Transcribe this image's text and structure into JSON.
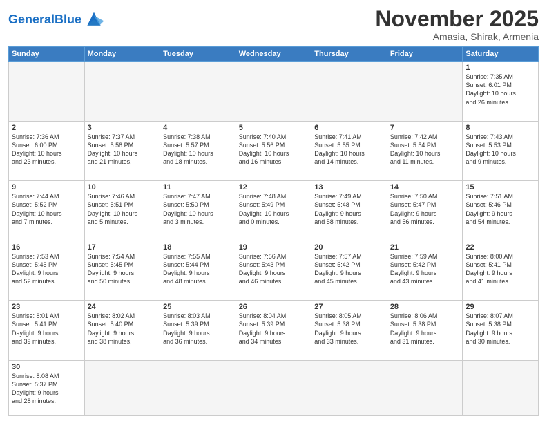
{
  "header": {
    "logo_general": "General",
    "logo_blue": "Blue",
    "month": "November 2025",
    "location": "Amasia, Shirak, Armenia"
  },
  "days_of_week": [
    "Sunday",
    "Monday",
    "Tuesday",
    "Wednesday",
    "Thursday",
    "Friday",
    "Saturday"
  ],
  "weeks": [
    [
      {
        "day": "",
        "info": ""
      },
      {
        "day": "",
        "info": ""
      },
      {
        "day": "",
        "info": ""
      },
      {
        "day": "",
        "info": ""
      },
      {
        "day": "",
        "info": ""
      },
      {
        "day": "",
        "info": ""
      },
      {
        "day": "1",
        "info": "Sunrise: 7:35 AM\nSunset: 6:01 PM\nDaylight: 10 hours\nand 26 minutes."
      }
    ],
    [
      {
        "day": "2",
        "info": "Sunrise: 7:36 AM\nSunset: 6:00 PM\nDaylight: 10 hours\nand 23 minutes."
      },
      {
        "day": "3",
        "info": "Sunrise: 7:37 AM\nSunset: 5:58 PM\nDaylight: 10 hours\nand 21 minutes."
      },
      {
        "day": "4",
        "info": "Sunrise: 7:38 AM\nSunset: 5:57 PM\nDaylight: 10 hours\nand 18 minutes."
      },
      {
        "day": "5",
        "info": "Sunrise: 7:40 AM\nSunset: 5:56 PM\nDaylight: 10 hours\nand 16 minutes."
      },
      {
        "day": "6",
        "info": "Sunrise: 7:41 AM\nSunset: 5:55 PM\nDaylight: 10 hours\nand 14 minutes."
      },
      {
        "day": "7",
        "info": "Sunrise: 7:42 AM\nSunset: 5:54 PM\nDaylight: 10 hours\nand 11 minutes."
      },
      {
        "day": "8",
        "info": "Sunrise: 7:43 AM\nSunset: 5:53 PM\nDaylight: 10 hours\nand 9 minutes."
      }
    ],
    [
      {
        "day": "9",
        "info": "Sunrise: 7:44 AM\nSunset: 5:52 PM\nDaylight: 10 hours\nand 7 minutes."
      },
      {
        "day": "10",
        "info": "Sunrise: 7:46 AM\nSunset: 5:51 PM\nDaylight: 10 hours\nand 5 minutes."
      },
      {
        "day": "11",
        "info": "Sunrise: 7:47 AM\nSunset: 5:50 PM\nDaylight: 10 hours\nand 3 minutes."
      },
      {
        "day": "12",
        "info": "Sunrise: 7:48 AM\nSunset: 5:49 PM\nDaylight: 10 hours\nand 0 minutes."
      },
      {
        "day": "13",
        "info": "Sunrise: 7:49 AM\nSunset: 5:48 PM\nDaylight: 9 hours\nand 58 minutes."
      },
      {
        "day": "14",
        "info": "Sunrise: 7:50 AM\nSunset: 5:47 PM\nDaylight: 9 hours\nand 56 minutes."
      },
      {
        "day": "15",
        "info": "Sunrise: 7:51 AM\nSunset: 5:46 PM\nDaylight: 9 hours\nand 54 minutes."
      }
    ],
    [
      {
        "day": "16",
        "info": "Sunrise: 7:53 AM\nSunset: 5:45 PM\nDaylight: 9 hours\nand 52 minutes."
      },
      {
        "day": "17",
        "info": "Sunrise: 7:54 AM\nSunset: 5:45 PM\nDaylight: 9 hours\nand 50 minutes."
      },
      {
        "day": "18",
        "info": "Sunrise: 7:55 AM\nSunset: 5:44 PM\nDaylight: 9 hours\nand 48 minutes."
      },
      {
        "day": "19",
        "info": "Sunrise: 7:56 AM\nSunset: 5:43 PM\nDaylight: 9 hours\nand 46 minutes."
      },
      {
        "day": "20",
        "info": "Sunrise: 7:57 AM\nSunset: 5:42 PM\nDaylight: 9 hours\nand 45 minutes."
      },
      {
        "day": "21",
        "info": "Sunrise: 7:59 AM\nSunset: 5:42 PM\nDaylight: 9 hours\nand 43 minutes."
      },
      {
        "day": "22",
        "info": "Sunrise: 8:00 AM\nSunset: 5:41 PM\nDaylight: 9 hours\nand 41 minutes."
      }
    ],
    [
      {
        "day": "23",
        "info": "Sunrise: 8:01 AM\nSunset: 5:41 PM\nDaylight: 9 hours\nand 39 minutes."
      },
      {
        "day": "24",
        "info": "Sunrise: 8:02 AM\nSunset: 5:40 PM\nDaylight: 9 hours\nand 38 minutes."
      },
      {
        "day": "25",
        "info": "Sunrise: 8:03 AM\nSunset: 5:39 PM\nDaylight: 9 hours\nand 36 minutes."
      },
      {
        "day": "26",
        "info": "Sunrise: 8:04 AM\nSunset: 5:39 PM\nDaylight: 9 hours\nand 34 minutes."
      },
      {
        "day": "27",
        "info": "Sunrise: 8:05 AM\nSunset: 5:38 PM\nDaylight: 9 hours\nand 33 minutes."
      },
      {
        "day": "28",
        "info": "Sunrise: 8:06 AM\nSunset: 5:38 PM\nDaylight: 9 hours\nand 31 minutes."
      },
      {
        "day": "29",
        "info": "Sunrise: 8:07 AM\nSunset: 5:38 PM\nDaylight: 9 hours\nand 30 minutes."
      }
    ],
    [
      {
        "day": "30",
        "info": "Sunrise: 8:08 AM\nSunset: 5:37 PM\nDaylight: 9 hours\nand 28 minutes."
      },
      {
        "day": "",
        "info": ""
      },
      {
        "day": "",
        "info": ""
      },
      {
        "day": "",
        "info": ""
      },
      {
        "day": "",
        "info": ""
      },
      {
        "day": "",
        "info": ""
      },
      {
        "day": "",
        "info": ""
      }
    ]
  ]
}
